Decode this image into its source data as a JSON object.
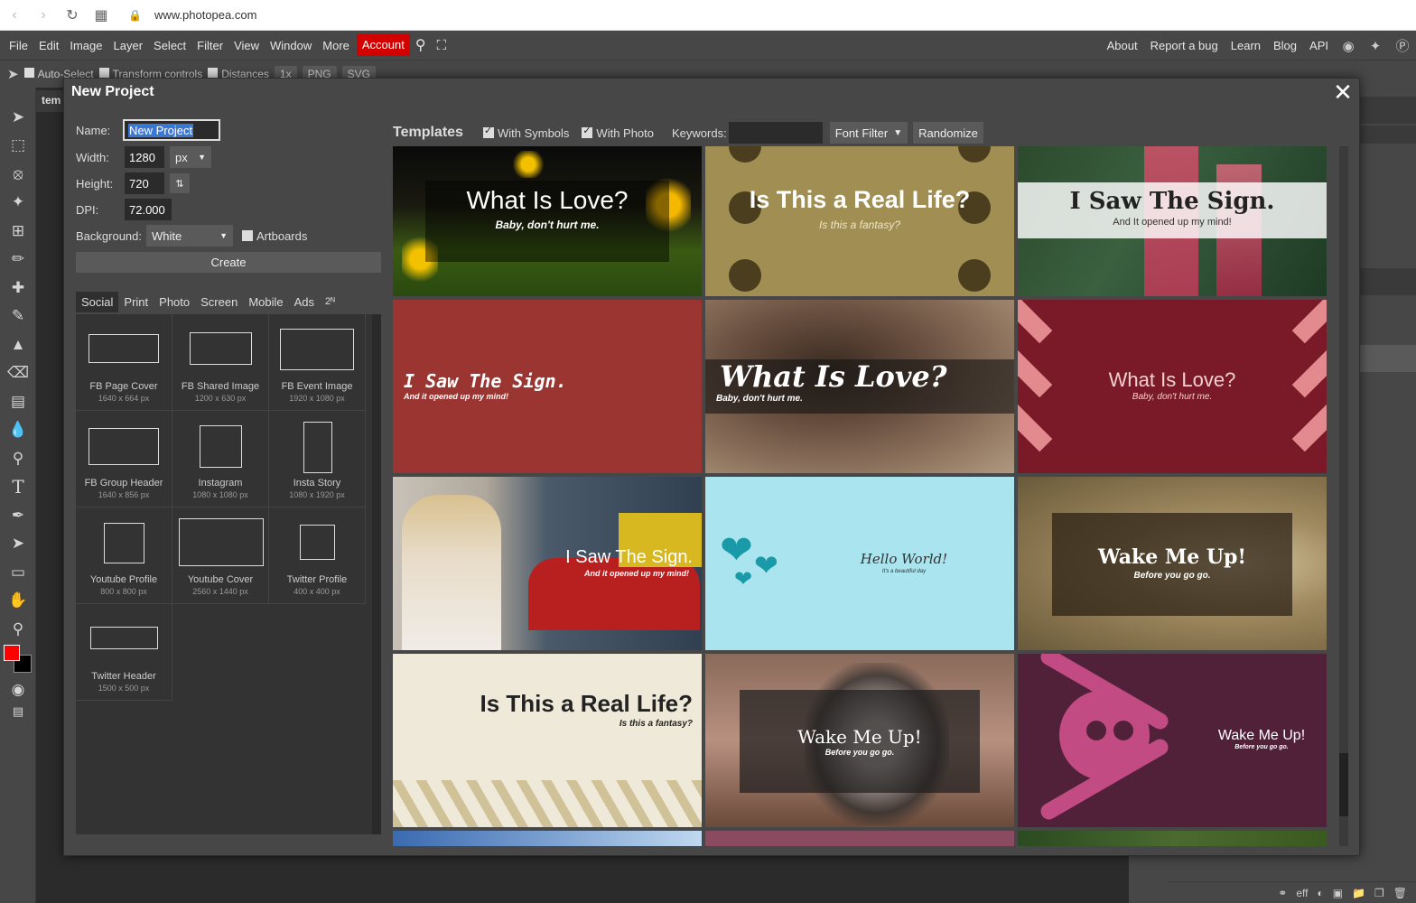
{
  "browser": {
    "url": "www.photopea.com"
  },
  "menu": {
    "left": [
      "File",
      "Edit",
      "Image",
      "Layer",
      "Select",
      "Filter",
      "View",
      "Window",
      "More"
    ],
    "account": "Account",
    "right": [
      "About",
      "Report a bug",
      "Learn",
      "Blog",
      "API"
    ]
  },
  "options_bar": {
    "auto_select": "Auto-Select",
    "transform_controls": "Transform controls",
    "distances": "Distances",
    "zoom": "1x",
    "png": "PNG",
    "svg": "SVG"
  },
  "document_tab": "tem",
  "status_bar": {
    "eff": "eff"
  },
  "dialog": {
    "title": "New Project",
    "close": "✕",
    "name_label": "Name:",
    "name_value": "New Project",
    "width_label": "Width:",
    "width_value": "1280",
    "unit": "px",
    "height_label": "Height:",
    "height_value": "720",
    "dpi_label": "DPI:",
    "dpi_value": "72.000",
    "background_label": "Background:",
    "background_value": "White",
    "artboards_label": "Artboards",
    "create_label": "Create",
    "categories": [
      "Social",
      "Print",
      "Photo",
      "Screen",
      "Mobile",
      "Ads",
      "2ᴺ"
    ],
    "presets": [
      {
        "name": "FB Page Cover",
        "size": "1640 x 664 px"
      },
      {
        "name": "FB Shared Image",
        "size": "1200 x 630 px"
      },
      {
        "name": "FB Event Image",
        "size": "1920 x 1080 px"
      },
      {
        "name": "FB Group Header",
        "size": "1640 x 856 px"
      },
      {
        "name": "Instagram",
        "size": "1080 x 1080 px"
      },
      {
        "name": "Insta Story",
        "size": "1080 x 1920 px"
      },
      {
        "name": "Youtube Profile",
        "size": "800 x 800 px"
      },
      {
        "name": "Youtube Cover",
        "size": "2560 x 1440 px"
      },
      {
        "name": "Twitter Profile",
        "size": "400 x 400 px"
      },
      {
        "name": "Twitter Header",
        "size": "1500 x 500 px"
      }
    ],
    "templates_title": "Templates",
    "with_symbols": "With Symbols",
    "with_photo": "With Photo",
    "keywords_label": "Keywords:",
    "font_filter": "Font Filter",
    "randomize": "Randomize",
    "templates": [
      {
        "title": "What Is Love?",
        "sub": "Baby, don't hurt me."
      },
      {
        "title": "Is This a Real Life?",
        "sub": "Is this a fantasy?"
      },
      {
        "title": "I Saw The Sign.",
        "sub": "And It opened up my mind!"
      },
      {
        "title": "I Saw The Sign.",
        "sub": "And it opened up my mind!"
      },
      {
        "title": "What Is Love?",
        "sub": "Baby, don't hurt me."
      },
      {
        "title": "What Is Love?",
        "sub": "Baby, don't hurt me."
      },
      {
        "title": "I Saw The Sign.",
        "sub": "And it opened up my mind!"
      },
      {
        "title": "Hello World!",
        "sub": "It's a beautiful day"
      },
      {
        "title": "Wake Me Up!",
        "sub": "Before you go go."
      },
      {
        "title": "Is This a Real Life?",
        "sub": "Is this a fantasy?"
      },
      {
        "title": "Wake Me Up!",
        "sub": "Before you go go."
      },
      {
        "title": "Wake Me Up!",
        "sub": "Before you go go."
      }
    ]
  },
  "colors": {
    "accent": "#d30000",
    "foreground": "#ff0000",
    "background": "#000000",
    "selection": "#3a78d6"
  }
}
